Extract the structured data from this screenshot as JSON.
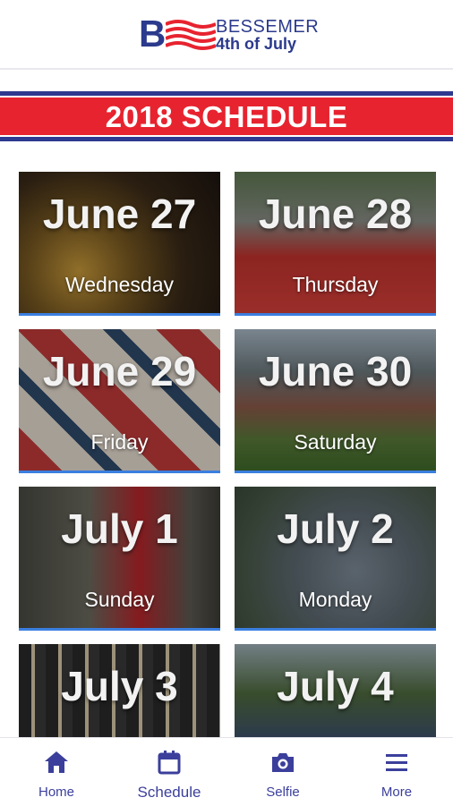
{
  "header": {
    "logo_letter": "B",
    "logo_line1": "BESSEMER",
    "logo_line2": "4th of July"
  },
  "banner": {
    "title": "2018 SCHEDULE"
  },
  "days": [
    {
      "date": "June 27",
      "day": "Wednesday"
    },
    {
      "date": "June 28",
      "day": "Thursday"
    },
    {
      "date": "June 29",
      "day": "Friday"
    },
    {
      "date": "June 30",
      "day": "Saturday"
    },
    {
      "date": "July 1",
      "day": "Sunday"
    },
    {
      "date": "July 2",
      "day": "Monday"
    },
    {
      "date": "July 3",
      "day": ""
    },
    {
      "date": "July 4",
      "day": ""
    }
  ],
  "nav": [
    {
      "label": "Home",
      "icon": "home-icon"
    },
    {
      "label": "Schedule",
      "icon": "calendar-icon"
    },
    {
      "label": "Selfie",
      "icon": "camera-icon"
    },
    {
      "label": "More",
      "icon": "menu-icon"
    }
  ],
  "colors": {
    "brand_blue": "#2e3a8f",
    "brand_red": "#e7232f",
    "nav_text": "#3b3f9b",
    "tile_underline": "#3b7fe0"
  }
}
